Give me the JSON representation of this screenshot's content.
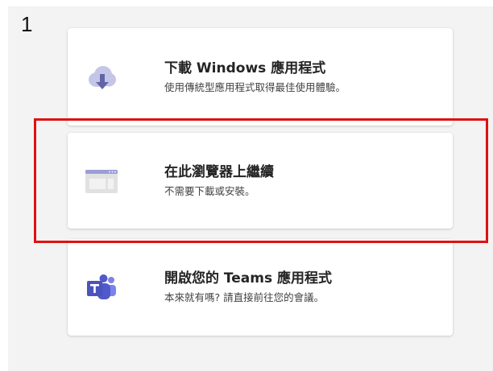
{
  "step_label": "1",
  "options": {
    "download": {
      "title": "下載 Windows 應用程式",
      "subtitle": "使用傳統型應用程式取得最佳使用體驗。",
      "icon": "cloud-download-icon"
    },
    "browser": {
      "title": "在此瀏覽器上繼續",
      "subtitle": "不需要下載或安裝。",
      "icon": "browser-window-icon"
    },
    "teams_app": {
      "title": "開啟您的 Teams 應用程式",
      "subtitle": "本來就有嗎? 請直接前往您的會議。",
      "icon": "teams-logo-icon"
    }
  },
  "colors": {
    "highlight": "#e01010",
    "accent": "#6264a7",
    "accent_light": "#c5c5e8",
    "card_background": "#ffffff",
    "panel_background": "#f3f3f3"
  }
}
